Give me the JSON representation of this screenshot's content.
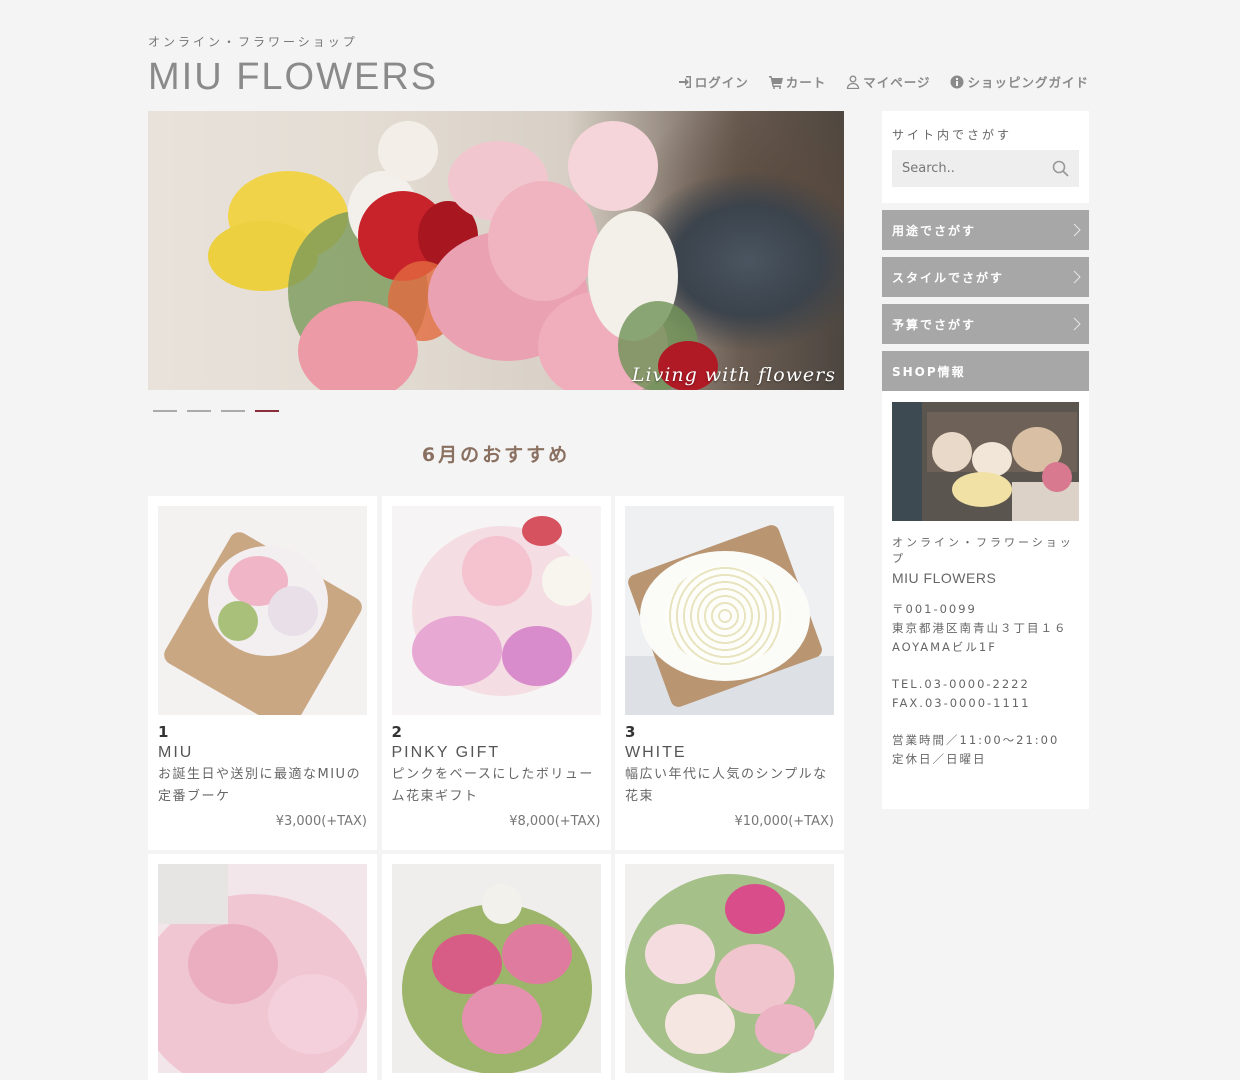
{
  "header": {
    "tagline": "オンライン・フラワーショップ",
    "logo": "MIU FLOWERS",
    "nav": [
      {
        "label": "ログイン",
        "icon": "login-icon"
      },
      {
        "label": "カート",
        "icon": "cart-icon"
      },
      {
        "label": "マイページ",
        "icon": "user-icon"
      },
      {
        "label": "ショッピングガイド",
        "icon": "info-icon"
      }
    ]
  },
  "hero": {
    "caption": "Living with flowers",
    "slides": 4,
    "active_slide": 4,
    "accent_color": "#8c2e3a"
  },
  "section": {
    "title": "6月のおすすめ"
  },
  "products": [
    {
      "rank": "1",
      "name": "MIU",
      "desc": "お誕生日や送別に最適なMIUの定番ブーケ",
      "price": "¥3,000(+TAX)"
    },
    {
      "rank": "2",
      "name": "PINKY GIFT",
      "desc": "ピンクをベースにしたボリューム花束ギフト",
      "price": "¥8,000(+TAX)"
    },
    {
      "rank": "3",
      "name": "WHITE",
      "desc": "幅広い年代に人気のシンプルな花束",
      "price": "¥10,000(+TAX)"
    }
  ],
  "sidebar": {
    "search_label": "サイト内でさがす",
    "search_placeholder": "Search..",
    "menu": [
      "用途でさがす",
      "スタイルでさがす",
      "予算でさがす"
    ],
    "shop_heading": "SHOP情報",
    "shop_tagline": "オンライン・フラワーショップ",
    "shop_name": "MIU FLOWERS",
    "address": "〒001-0099\n東京都港区南青山３丁目１６\nAOYAMAビル1F",
    "contact": "TEL.03-0000-2222\nFAX.03-0000-1111",
    "hours": "営業時間／11:00〜21:00\n定休日／日曜日"
  },
  "colors": {
    "background": "#f4f4f4",
    "menu_gray": "#a7a7a7",
    "title_brown": "#8a7060"
  }
}
